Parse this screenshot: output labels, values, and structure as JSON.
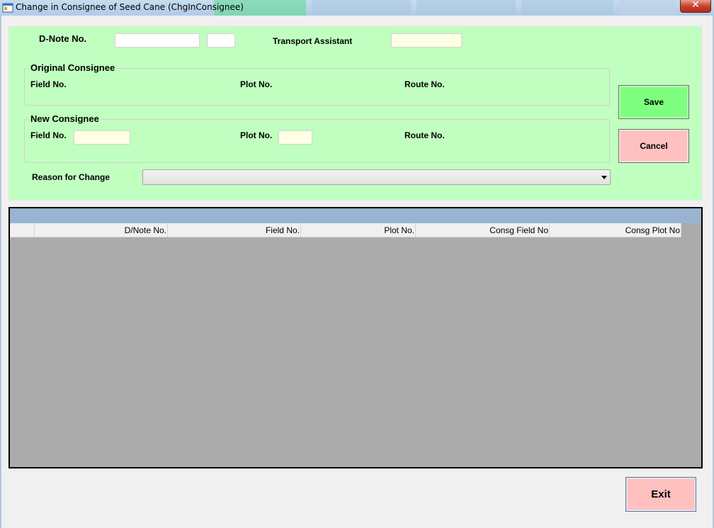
{
  "window": {
    "title": "Change in Consignee of Seed Cane (ChgInConsignee)",
    "close_glyph": "✕"
  },
  "header": {
    "dnote_label": "D-Note No.",
    "dnote_value": "",
    "dnote_suffix_value": "",
    "transport_assistant_label": "Transport Assistant",
    "transport_assistant_value": ""
  },
  "original_consignee": {
    "title": "Original Consignee",
    "field_label": "Field No.",
    "plot_label": "Plot No.",
    "route_label": "Route No."
  },
  "new_consignee": {
    "title": "New Consignee",
    "field_label": "Field No.",
    "field_value": "",
    "plot_label": "Plot No.",
    "plot_value": "",
    "route_label": "Route No."
  },
  "reason": {
    "label": "Reason for Change",
    "selected": ""
  },
  "buttons": {
    "save": "Save",
    "cancel": "Cancel",
    "exit": "Exit"
  },
  "grid": {
    "columns": [
      "D/Note No.",
      "Field No.",
      "Plot No.",
      "Consg Field No",
      "Consg Plot No"
    ],
    "rows": []
  },
  "colors": {
    "panel_bg": "#c0ffc0",
    "save_bg": "#7fff7f",
    "cancel_bg": "#ffc0c0",
    "grid_bg": "#ababab",
    "grid_caption_bg": "#99b4d1"
  },
  "icons": {
    "app": "app-window-icon",
    "close": "close-icon",
    "dropdown": "chevron-down-icon"
  }
}
